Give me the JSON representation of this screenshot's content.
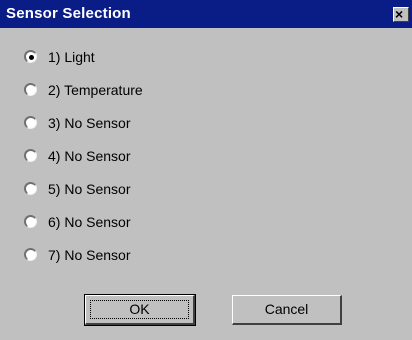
{
  "window": {
    "title": "Sensor Selection"
  },
  "sensors": [
    {
      "label": "1) Light",
      "selected": true
    },
    {
      "label": "2) Temperature",
      "selected": false
    },
    {
      "label": "3) No Sensor",
      "selected": false
    },
    {
      "label": "4) No Sensor",
      "selected": false
    },
    {
      "label": "5) No Sensor",
      "selected": false
    },
    {
      "label": "6) No Sensor",
      "selected": false
    },
    {
      "label": "7) No Sensor",
      "selected": false
    }
  ],
  "buttons": {
    "ok_label": "OK",
    "cancel_label": "Cancel"
  },
  "icons": {
    "close": "close-icon",
    "radio": "radio-icon"
  },
  "colors": {
    "titlebar": "#0a1c86",
    "face": "#c0c0c0"
  }
}
